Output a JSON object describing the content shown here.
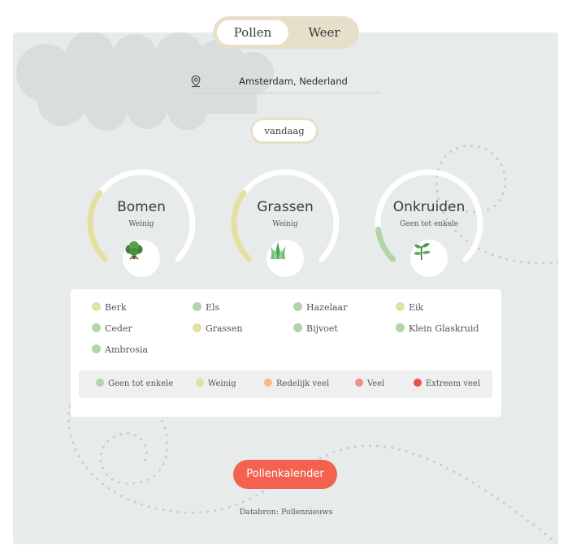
{
  "tabs": {
    "active": "Pollen",
    "other": "Weer"
  },
  "location": {
    "value": "Amsterdam, Nederland"
  },
  "date": {
    "label": "vandaag"
  },
  "gauges": [
    {
      "title": "Bomen",
      "level": "Weinig",
      "icon": "tree-icon",
      "color": "#e3e0a0",
      "fill": 0.3
    },
    {
      "title": "Grassen",
      "level": "Weinig",
      "icon": "grass-icon",
      "color": "#e3e0a0",
      "fill": 0.3
    },
    {
      "title": "Onkruiden",
      "level": "Geen tot enkele",
      "icon": "herb-icon",
      "color": "#b3d4aa",
      "fill": 0.14
    }
  ],
  "plants": [
    {
      "name": "Berk",
      "color": "#e3e0a0"
    },
    {
      "name": "Els",
      "color": "#b3d4aa"
    },
    {
      "name": "Hazelaar",
      "color": "#b3d4aa"
    },
    {
      "name": "Eik",
      "color": "#e3e0a0"
    },
    {
      "name": "Ceder",
      "color": "#b3d4aa"
    },
    {
      "name": "Grassen",
      "color": "#e3e0a0"
    },
    {
      "name": "Bijvoet",
      "color": "#b3d4aa"
    },
    {
      "name": "Klein Glaskruid",
      "color": "#b3d4aa"
    },
    {
      "name": "Ambrosia",
      "color": "#b3d4aa"
    }
  ],
  "legend": [
    {
      "label": "Geen tot enkele",
      "color": "#b3d4aa"
    },
    {
      "label": "Weinig",
      "color": "#e3e0a0"
    },
    {
      "label": "Redelijk veel",
      "color": "#f5b98f"
    },
    {
      "label": "Veel",
      "color": "#f08f86"
    },
    {
      "label": "Extreem veel",
      "color": "#e8514b"
    }
  ],
  "cta": {
    "label": "Pollenkalender"
  },
  "source": {
    "text": "Databron: Pollennieuws"
  }
}
